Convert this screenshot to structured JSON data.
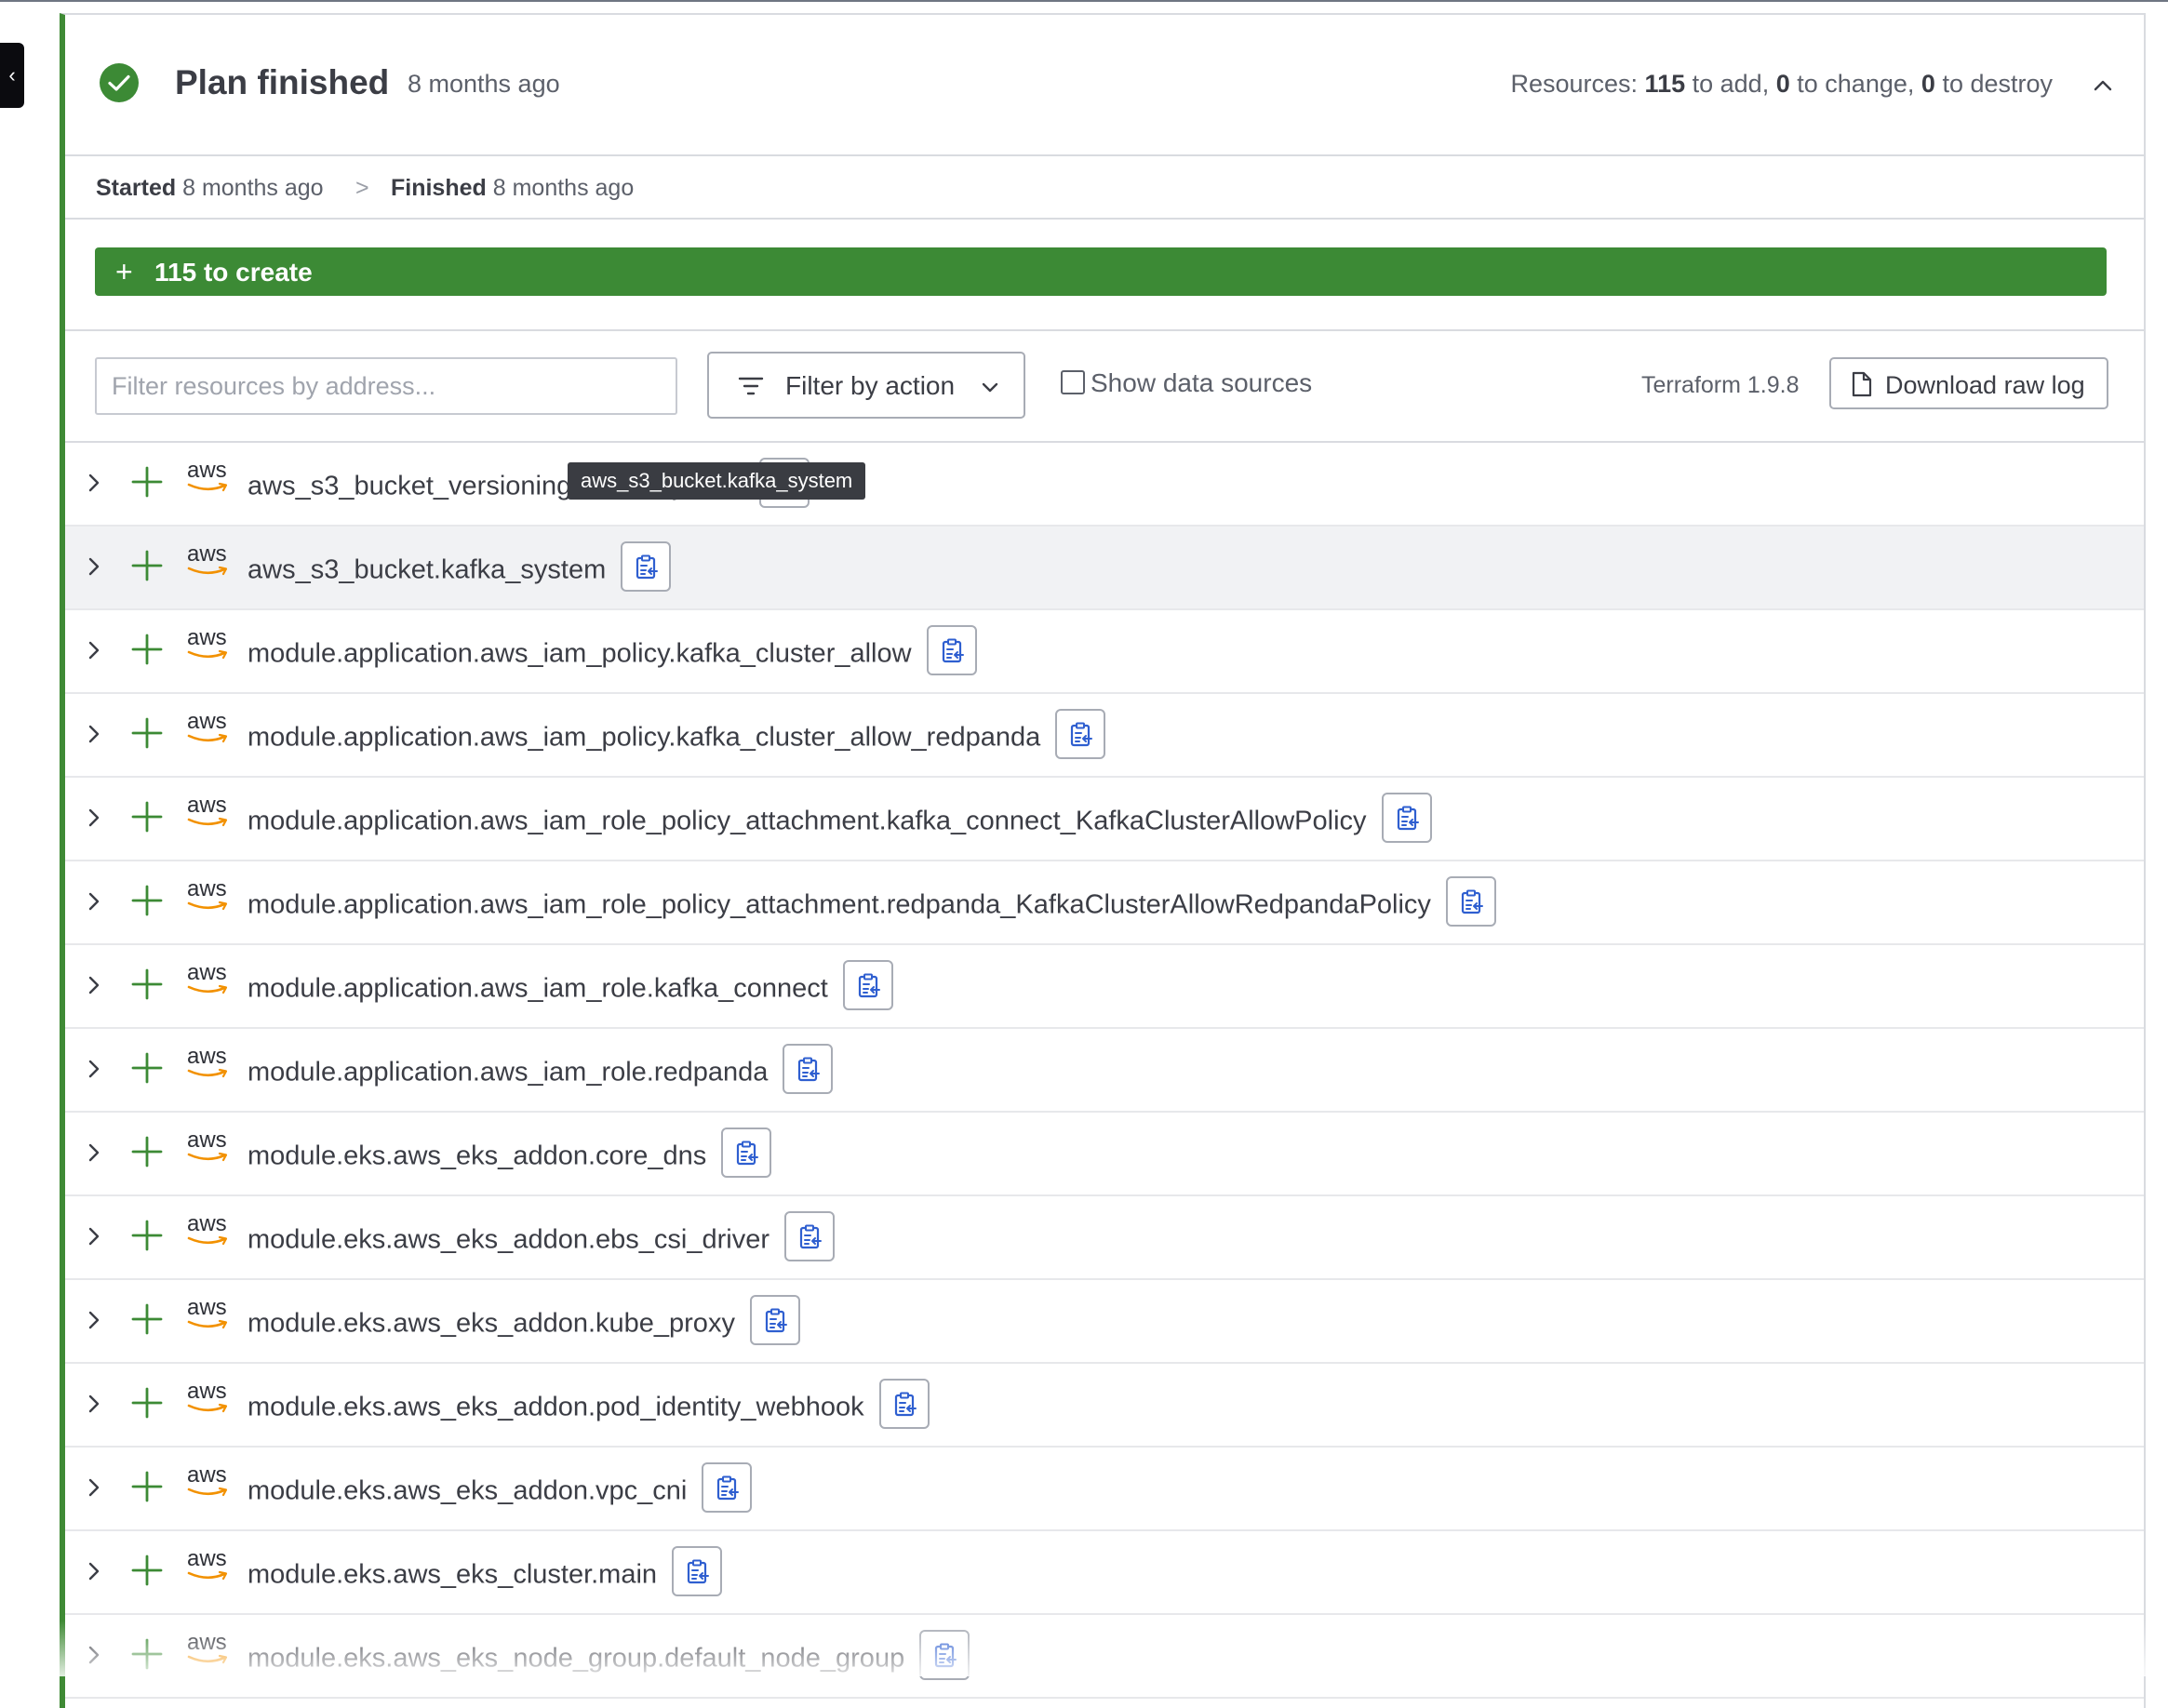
{
  "sidebar_toggle": {
    "glyph": "‹"
  },
  "header": {
    "title": "Plan finished",
    "time": "8 months ago",
    "resources": {
      "prefix": "Resources:",
      "add_count": "115",
      "add_label": "to add,",
      "change_count": "0",
      "change_label": "to change,",
      "destroy_count": "0",
      "destroy_label": "to destroy"
    }
  },
  "timing": {
    "started_label": "Started",
    "started_value": "8 months ago",
    "separator": ">",
    "finished_label": "Finished",
    "finished_value": "8 months ago"
  },
  "create_bar": {
    "plus": "+",
    "label": "115 to create"
  },
  "toolbar": {
    "filter_placeholder": "Filter resources by address...",
    "filter_action_label": "Filter by action",
    "show_data_sources_label": "Show data sources",
    "terraform_version": "Terraform 1.9.8",
    "download_label": "Download raw log"
  },
  "provider_label": "aws",
  "tooltip": "aws_s3_bucket.kafka_system",
  "rows": [
    {
      "address": "aws_s3_bucket_versioning.kafka_system"
    },
    {
      "address": "aws_s3_bucket.kafka_system"
    },
    {
      "address": "module.application.aws_iam_policy.kafka_cluster_allow"
    },
    {
      "address": "module.application.aws_iam_policy.kafka_cluster_allow_redpanda"
    },
    {
      "address": "module.application.aws_iam_role_policy_attachment.kafka_connect_KafkaClusterAllowPolicy"
    },
    {
      "address": "module.application.aws_iam_role_policy_attachment.redpanda_KafkaClusterAllowRedpandaPolicy"
    },
    {
      "address": "module.application.aws_iam_role.kafka_connect"
    },
    {
      "address": "module.application.aws_iam_role.redpanda"
    },
    {
      "address": "module.eks.aws_eks_addon.core_dns"
    },
    {
      "address": "module.eks.aws_eks_addon.ebs_csi_driver"
    },
    {
      "address": "module.eks.aws_eks_addon.kube_proxy"
    },
    {
      "address": "module.eks.aws_eks_addon.pod_identity_webhook"
    },
    {
      "address": "module.eks.aws_eks_addon.vpc_cni"
    },
    {
      "address": "module.eks.aws_eks_cluster.main"
    },
    {
      "address": "module.eks.aws_eks_node_group.default_node_group"
    }
  ],
  "colors": {
    "success_green": "#3c8a35",
    "copy_icon_blue": "#2f5fd0",
    "aws_orange": "#f29100"
  }
}
